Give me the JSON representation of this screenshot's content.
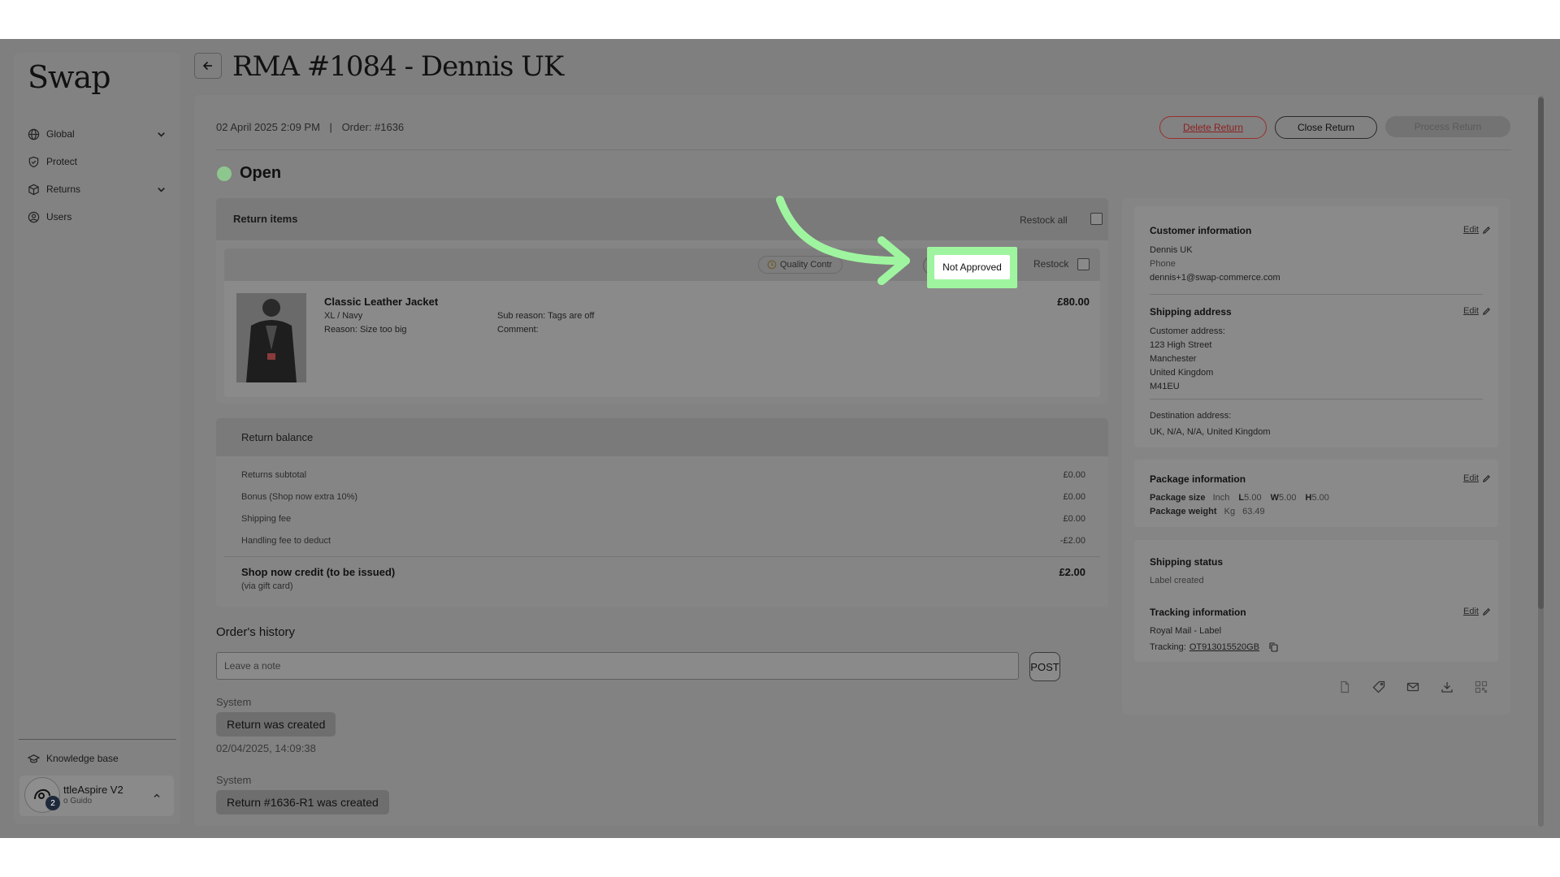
{
  "sidebar": {
    "logo": "Swap",
    "items": [
      {
        "label": "Global",
        "icon": "globe-icon",
        "has_chevron": true
      },
      {
        "label": "Protect",
        "icon": "shield-icon",
        "has_chevron": false
      },
      {
        "label": "Returns",
        "icon": "box-icon",
        "has_chevron": true
      },
      {
        "label": "Users",
        "icon": "user-circle-icon",
        "has_chevron": false
      }
    ],
    "knowledge_base": "Knowledge base",
    "user": {
      "name": "ttleAspire V2",
      "sub": "o Guido",
      "badge": "2"
    }
  },
  "header": {
    "title": "RMA #1084 - Dennis UK"
  },
  "meta": {
    "date": "02 April 2025 2:09 PM",
    "separator": "|",
    "order": "Order: #1636"
  },
  "actions": {
    "delete": "Delete Return",
    "close": "Close Return",
    "process": "Process Return"
  },
  "status": {
    "label": "Open",
    "color": "#8ec78e"
  },
  "return_items": {
    "title": "Return items",
    "restock_all": "Restock all",
    "quality_control": "Quality Contr",
    "not_approved": "Not Approved",
    "restock": "Restock",
    "item": {
      "name": "Classic Leather Jacket",
      "variant": "XL / Navy",
      "reason": "Reason: Size too big",
      "sub_reason": "Sub reason: Tags are off",
      "comment": "Comment:",
      "price": "£80.00"
    }
  },
  "return_balance": {
    "title": "Return balance",
    "rows": [
      {
        "label": "Returns subtotal",
        "value": "£0.00"
      },
      {
        "label": "Bonus (Shop now extra 10%)",
        "value": "£0.00"
      },
      {
        "label": "Shipping fee",
        "value": "£0.00"
      },
      {
        "label": "Handling fee to deduct",
        "value": "-£2.00"
      }
    ],
    "total_label": "Shop now credit (to be issued)",
    "total_sub": "(via gift card)",
    "total_value": "£2.00"
  },
  "history": {
    "title": "Order's history",
    "note_placeholder": "Leave a note",
    "post": "POST",
    "entries": [
      {
        "author": "System",
        "text": "Return was created",
        "time": "02/04/2025, 14:09:38"
      },
      {
        "author": "System",
        "text": "Return #1636-R1 was created"
      }
    ]
  },
  "customer": {
    "title": "Customer information",
    "edit": "Edit",
    "name": "Dennis UK",
    "phone": "Phone",
    "email": "dennis+1@swap-commerce.com"
  },
  "shipping_address": {
    "title": "Shipping address",
    "edit": "Edit",
    "customer_label": "Customer address:",
    "lines": [
      "123 High Street",
      "Manchester",
      "United Kingdom",
      "M41EU"
    ],
    "destination_label": "Destination address:",
    "destination": "UK, N/A, N/A, United Kingdom"
  },
  "package": {
    "title": "Package information",
    "edit": "Edit",
    "size_label": "Package size",
    "size_unit": "Inch",
    "l_label": "L",
    "l": "5.00",
    "w_label": "W",
    "w": "5.00",
    "h_label": "H",
    "h": "5.00",
    "weight_label": "Package weight",
    "weight_unit": "Kg",
    "weight": "63.49"
  },
  "shipping_status": {
    "title": "Shipping status",
    "value": "Label created"
  },
  "tracking": {
    "title": "Tracking information",
    "edit": "Edit",
    "carrier": "Royal Mail - Label",
    "label": "Tracking:",
    "number": "OT913015520GB"
  },
  "highlight": {
    "color": "#9ff59f"
  }
}
